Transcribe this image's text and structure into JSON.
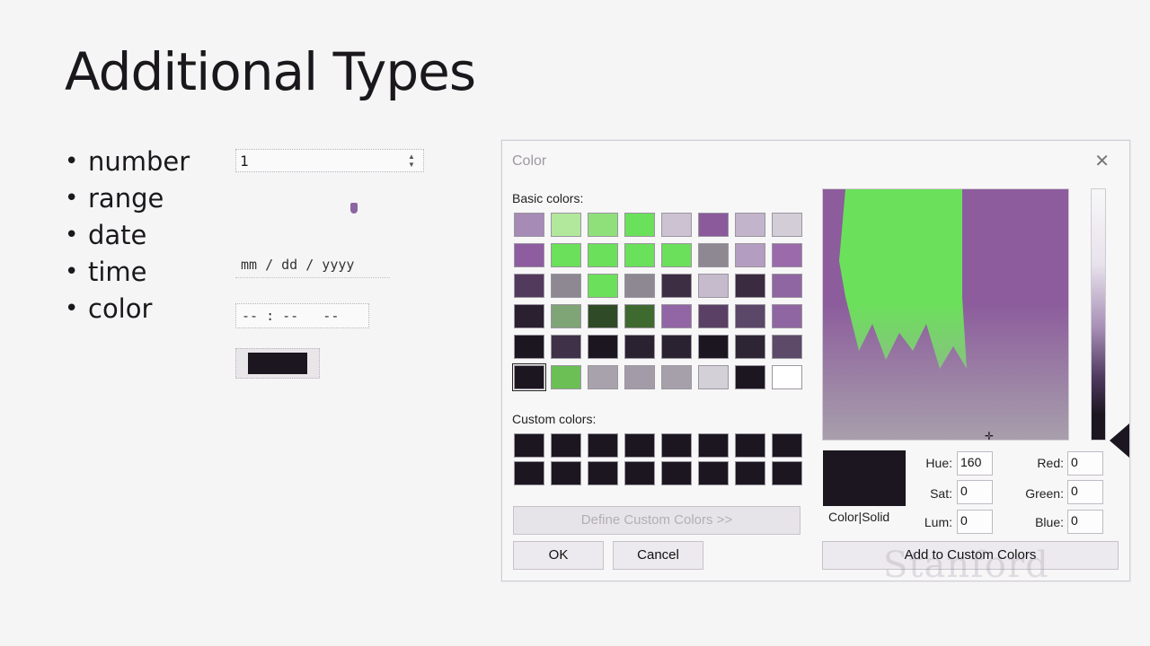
{
  "slide": {
    "title": "Additional Types",
    "bullets": [
      "number",
      "range",
      "date",
      "time",
      "color"
    ]
  },
  "inputs": {
    "number_value": "1",
    "range_value": 0.97,
    "date_placeholder": "mm / dd / yyyy",
    "time_placeholder": "-- : --   --",
    "color_value": "#1c1620"
  },
  "dialog": {
    "title": "Color",
    "close_icon": "close-icon",
    "basic_label": "Basic colors:",
    "custom_label": "Custom colors:",
    "define_button": "Define Custom Colors >>",
    "ok_button": "OK",
    "cancel_button": "Cancel",
    "add_button": "Add to Custom Colors",
    "preview_label": "Color|Solid",
    "hue_label": "Hue:",
    "sat_label": "Sat:",
    "lum_label": "Lum:",
    "red_label": "Red:",
    "green_label": "Green:",
    "blue_label": "Blue:",
    "hue": "160",
    "sat": "0",
    "lum": "0",
    "red": "0",
    "green": "0",
    "blue": "0",
    "watermark": "Stanford",
    "basic_colors": [
      "#a58bb6",
      "#b2e89c",
      "#8fe07a",
      "#6be05a",
      "#ccc2d2",
      "#8a5a9b",
      "#c2b4ca",
      "#d2cdd6",
      "#8d5da0",
      "#6be05a",
      "#6be05a",
      "#6be05a",
      "#6be05a",
      "#8e8893",
      "#b39dc0",
      "#9a6aab",
      "#523a5c",
      "#8e8893",
      "#6be05a",
      "#8e8893",
      "#3d2e44",
      "#c6bacd",
      "#3a2b40",
      "#9066a2",
      "#2a2030",
      "#7fa476",
      "#2f4a26",
      "#3e6a30",
      "#9266a5",
      "#5a4064",
      "#5b4768",
      "#9066a2",
      "#1c1620",
      "#3f3147",
      "#1c1620",
      "#2a2230",
      "#2b2231",
      "#1c1620",
      "#2d2533",
      "#5d4a68",
      "#1c1620",
      "#6bbf55",
      "#a8a2ac",
      "#a39ca8",
      "#a5a0a9",
      "#d4d0d7",
      "#1c1620",
      "#ffffff"
    ],
    "custom_colors": [
      "#1c1620",
      "#1c1620",
      "#1c1620",
      "#1c1620",
      "#1c1620",
      "#1c1620",
      "#1c1620",
      "#1c1620",
      "#1c1620",
      "#1c1620",
      "#1c1620",
      "#1c1620",
      "#1c1620",
      "#1c1620",
      "#1c1620",
      "#1c1620"
    ],
    "selected_basic_index": 40,
    "spectrum_colors": {
      "green": "#6be05a",
      "purple": "#8c5c9c",
      "gray": "#a8a0ac"
    }
  }
}
